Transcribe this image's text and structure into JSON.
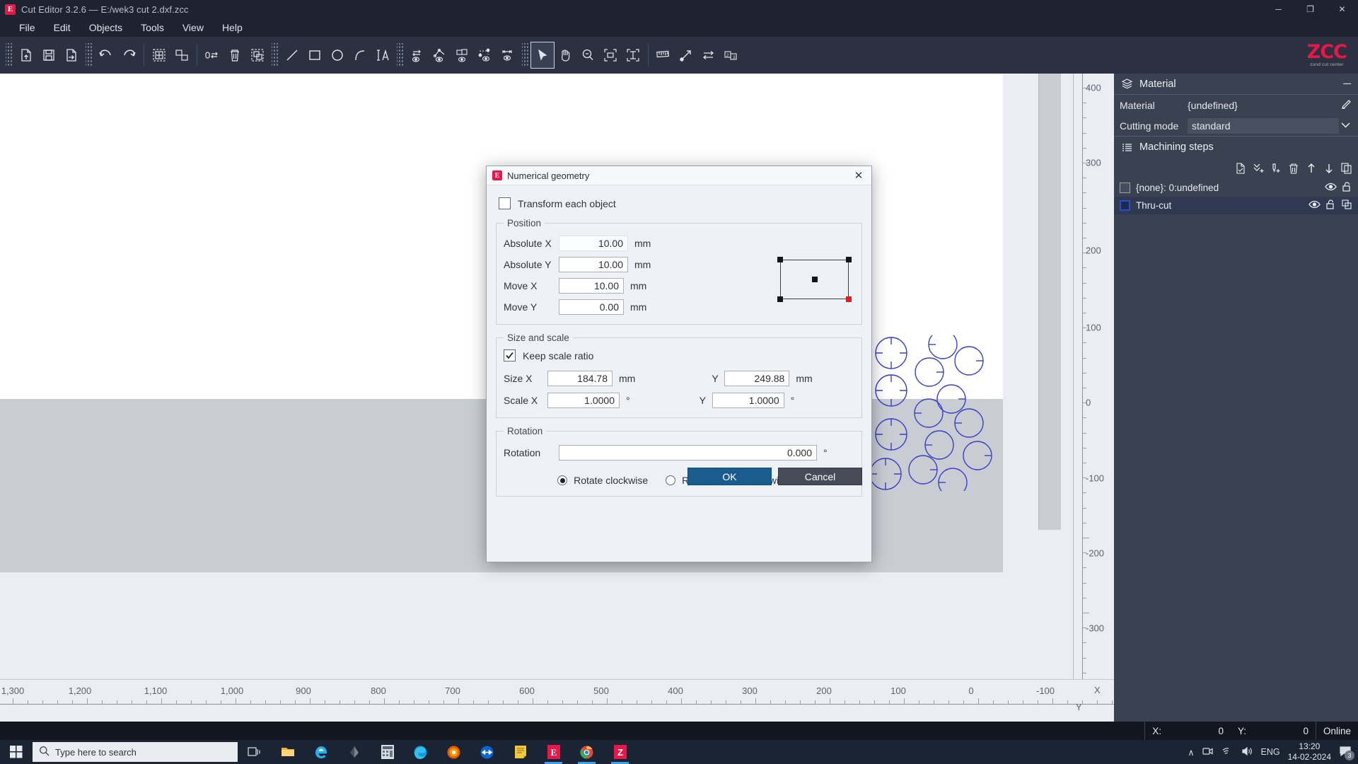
{
  "window": {
    "app_icon": "E",
    "title": "Cut Editor 3.2.6  —  E:/wek3 cut 2.dxf.zcc",
    "minimize": "─",
    "maximize": "❐",
    "close": "✕"
  },
  "menubar": {
    "items": [
      {
        "label": "File"
      },
      {
        "label": "Edit"
      },
      {
        "label": "Objects"
      },
      {
        "label": "Tools"
      },
      {
        "label": "View"
      },
      {
        "label": "Help"
      }
    ]
  },
  "toolbar": {
    "groups": [
      {
        "tools": [
          {
            "name": "import-icon"
          },
          {
            "name": "save-icon"
          },
          {
            "name": "export-icon"
          }
        ]
      },
      {
        "tools": [
          {
            "name": "undo-icon"
          },
          {
            "name": "redo-icon"
          },
          {
            "name": "group-icon"
          },
          {
            "name": "ungroup-icon"
          },
          {
            "name": "convert-icon"
          },
          {
            "name": "delete-icon"
          },
          {
            "name": "duplicate-icon"
          }
        ]
      },
      {
        "tools": [
          {
            "name": "line-tool-icon"
          },
          {
            "name": "rectangle-tool-icon"
          },
          {
            "name": "circle-tool-icon"
          },
          {
            "name": "arc-tool-icon"
          },
          {
            "name": "text-tool-icon"
          }
        ]
      },
      {
        "tools": [
          {
            "name": "show-direction-icon"
          },
          {
            "name": "show-nodes-icon"
          },
          {
            "name": "show-order-icon"
          },
          {
            "name": "show-points-icon"
          },
          {
            "name": "show-dimension-icon"
          }
        ]
      },
      {
        "tools": [
          {
            "name": "select-tool-icon",
            "active": true
          },
          {
            "name": "pan-tool-icon"
          },
          {
            "name": "zoom-tool-icon"
          },
          {
            "name": "zoom-fit-icon"
          },
          {
            "name": "zoom-height-icon"
          }
        ]
      },
      {
        "tools": [
          {
            "name": "measure-tool-icon"
          },
          {
            "name": "start-point-icon"
          },
          {
            "name": "reverse-direction-icon"
          },
          {
            "name": "sequence-icon"
          }
        ]
      }
    ],
    "logo": {
      "big": "ZCC",
      "small": "zund cut center"
    }
  },
  "canvas": {
    "ruler_h": {
      "labels": [
        "1,300",
        "1,200",
        "1,100",
        "1,000",
        "900",
        "800",
        "700",
        "600",
        "500",
        "400",
        "300",
        "200",
        "100",
        "0",
        "-100"
      ],
      "axis_label": "X"
    },
    "ruler_v": {
      "labels": [
        "400",
        "300",
        "200",
        "100",
        "0",
        "-100",
        "-200",
        "-300"
      ],
      "axis_label": "Y"
    }
  },
  "right_panel": {
    "material_header": {
      "title": "Material",
      "icon": "layers-icon",
      "minimize": "─"
    },
    "material_row": {
      "key": "Material",
      "value": "{undefined}",
      "edit_icon": "pencil-icon"
    },
    "cutting_mode_row": {
      "key": "Cutting mode",
      "value": "standard",
      "dropdown_icon": "chevron-down-icon"
    },
    "machining_header": {
      "title": "Machining steps",
      "icon": "list-icon"
    },
    "step_tools": [
      {
        "name": "new-step-icon"
      },
      {
        "name": "add-all-icon"
      },
      {
        "name": "add-tool-icon"
      },
      {
        "name": "delete-step-icon"
      },
      {
        "name": "move-up-icon"
      },
      {
        "name": "move-down-icon"
      },
      {
        "name": "copy-step-icon"
      }
    ],
    "steps": [
      {
        "label": "{none}: 0:undefined",
        "selected": false,
        "swatch": "grey",
        "icons": [
          {
            "name": "eye-icon"
          },
          {
            "name": "unlock-icon"
          }
        ]
      },
      {
        "label": "Thru-cut",
        "selected": true,
        "swatch": "blue",
        "icons": [
          {
            "name": "eye-icon"
          },
          {
            "name": "unlock-icon"
          },
          {
            "name": "duplicate-icon"
          }
        ]
      }
    ]
  },
  "dialog": {
    "icon": "E",
    "title": "Numerical geometry",
    "close": "✕",
    "transform_each": {
      "label": "Transform each object",
      "checked": false
    },
    "position": {
      "legend": "Position",
      "fields": [
        {
          "label": "Absolute X",
          "value": "10.00",
          "unit": "mm",
          "flat": true
        },
        {
          "label": "Absolute Y",
          "value": "10.00",
          "unit": "mm",
          "flat": false
        },
        {
          "label": "Move X",
          "value": "10.00",
          "unit": "mm",
          "flat": false
        },
        {
          "label": "Move Y",
          "value": "0.00",
          "unit": "mm",
          "flat": false
        }
      ],
      "anchor": {
        "name": "anchor-selector",
        "selected": "bottom-right"
      }
    },
    "size_scale": {
      "legend": "Size and scale",
      "keep_ratio": {
        "label": "Keep scale ratio",
        "checked": true
      },
      "rows": [
        {
          "label": "Size X",
          "value_x": "184.78",
          "unit_x": "mm",
          "label_y": "Y",
          "value_y": "249.88",
          "unit_y": "mm"
        },
        {
          "label": "Scale X",
          "value_x": "1.0000",
          "unit_x": "°",
          "label_y": "Y",
          "value_y": "1.0000",
          "unit_y": "°"
        }
      ]
    },
    "rotation": {
      "legend": "Rotation",
      "label": "Rotation",
      "value": "0.000",
      "unit": "°",
      "options": [
        {
          "label": "Rotate clockwise",
          "selected": true
        },
        {
          "label": "Rotate counterclockwise",
          "selected": false
        }
      ]
    },
    "buttons": {
      "ok": "OK",
      "cancel": "Cancel"
    }
  },
  "statusbar": {
    "x_label": "X:",
    "x_value": "0",
    "y_label": "Y:",
    "y_value": "0",
    "connection": "Online"
  },
  "taskbar": {
    "start_icon": "windows-icon",
    "search_placeholder": "Type here to search",
    "search_icon": "search-icon",
    "apps": [
      {
        "name": "taskview-icon"
      },
      {
        "name": "file-explorer-icon"
      },
      {
        "name": "internet-explorer-icon"
      },
      {
        "name": "paint3d-icon"
      },
      {
        "name": "calculator-icon"
      },
      {
        "name": "edge-icon"
      },
      {
        "name": "firefox-icon"
      },
      {
        "name": "teamviewer-icon"
      },
      {
        "name": "notepad-icon"
      },
      {
        "name": "cut-editor-icon"
      },
      {
        "name": "chrome-icon"
      },
      {
        "name": "zund-icon"
      }
    ],
    "tray": {
      "chevron": "∧",
      "icons": [
        {
          "name": "camera-icon"
        },
        {
          "name": "wifi-icon"
        },
        {
          "name": "volume-icon"
        }
      ],
      "language": "ENG",
      "time": "13:20",
      "date": "14-02-2024",
      "notifications": "3"
    }
  }
}
